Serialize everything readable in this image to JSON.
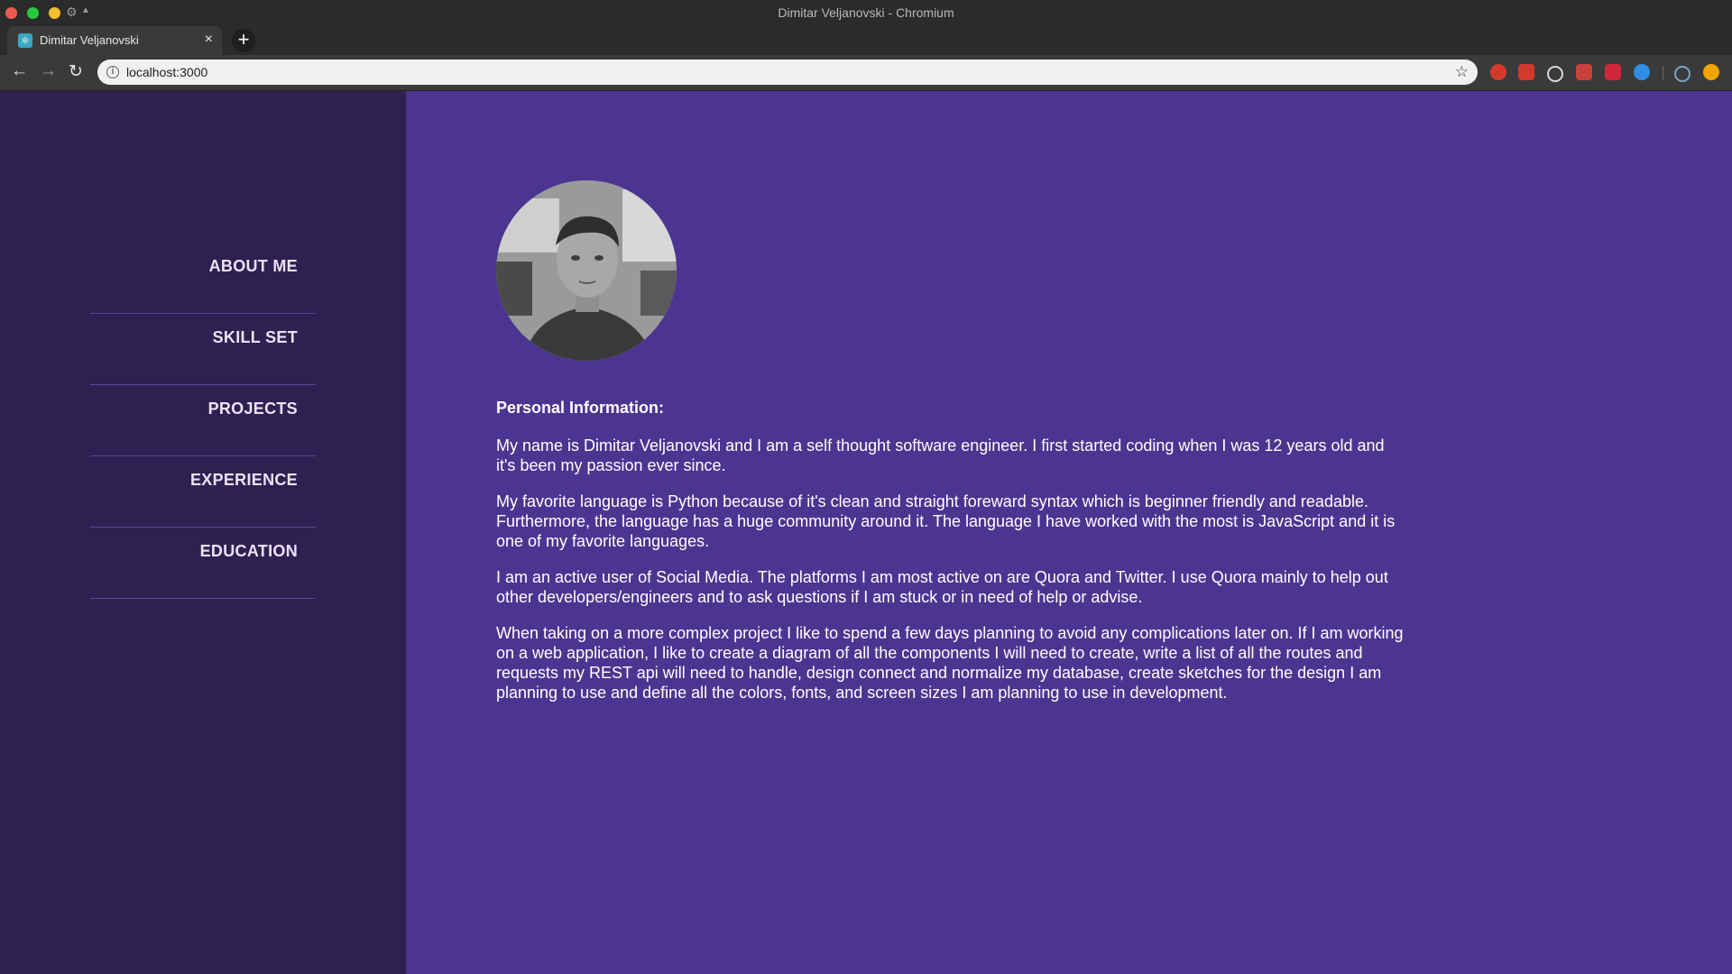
{
  "browser": {
    "window_title": "Dimitar Veljanovski - Chromium",
    "tab_title": "Dimitar Veljanovski",
    "url": "localhost:3000",
    "extensions": [
      "adblock-icon",
      "yab-icon",
      "target-icon",
      "calendar-icon",
      "video-icon",
      "info-icon",
      "react-icon",
      "warning-icon"
    ]
  },
  "sidebar": {
    "items": [
      {
        "label": "ABOUT ME"
      },
      {
        "label": "SKILL SET"
      },
      {
        "label": "PROJECTS"
      },
      {
        "label": "EXPERIENCE"
      },
      {
        "label": "EDUCATION"
      }
    ]
  },
  "main": {
    "heading": "Personal Information:",
    "paragraphs": [
      "My name is Dimitar Veljanovski and I am a self thought software engineer. I first started coding when I was 12 years old and it's been my passion ever since.",
      "My favorite language is Python because of it's clean and straight foreward syntax which is beginner friendly and readable. Furthermore, the language has a huge community around it. The language I have worked with the most is JavaScript and it is one of my favorite languages.",
      "I am an active user of Social Media. The platforms I am most active on are Quora and Twitter. I use Quora mainly to help out other developers/engineers and to ask questions if I am stuck or in need of help or advise.",
      "When taking on a more complex project I like to spend a few days planning to avoid any complications later on. If I am working on a web application, I like to create a diagram of all the components I will need to create, write a list of all the routes and requests my REST api will need to handle, design connect and normalize my database, create sketches for the design I am planning to use and define all the colors, fonts, and screen sizes I am planning to use in development."
    ]
  },
  "colors": {
    "sidebar_bg": "#2e2152",
    "main_bg": "#4c3591",
    "divider": "#584493",
    "text": "#ffffff"
  }
}
